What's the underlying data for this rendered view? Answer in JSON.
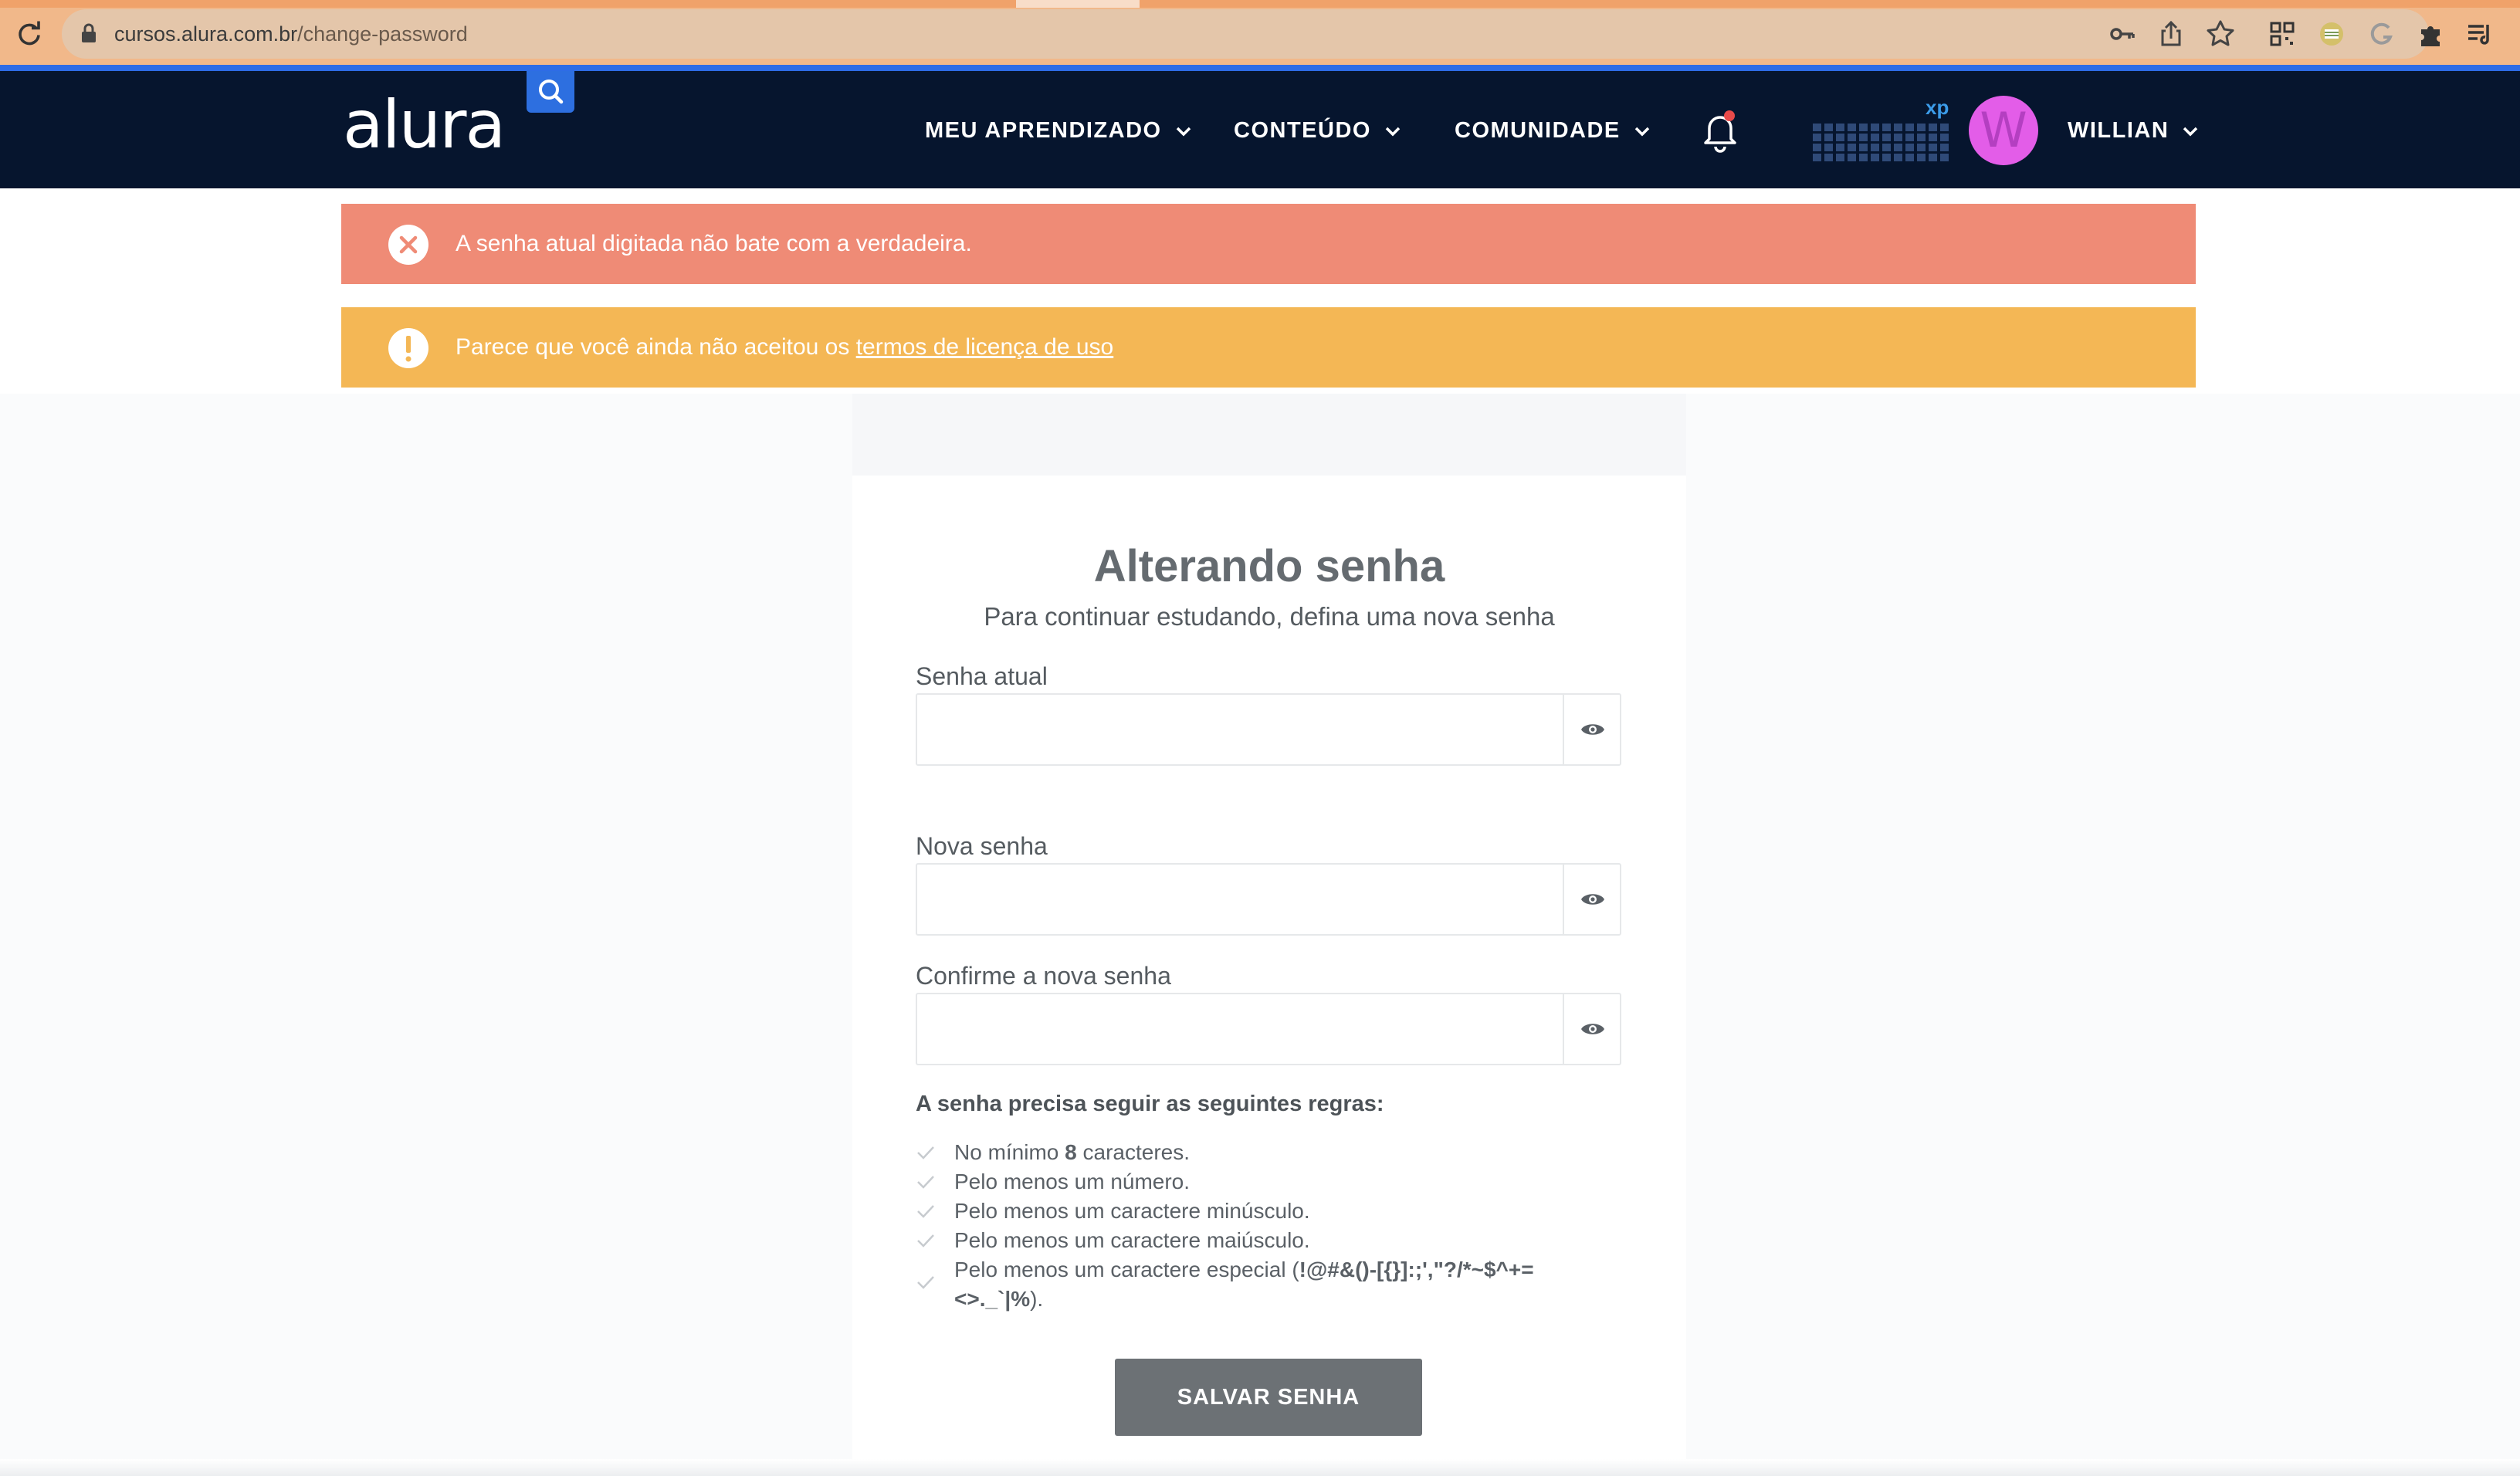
{
  "browser": {
    "url_domain": "cursos.alura.com.br",
    "url_path": "/change-password"
  },
  "header": {
    "logo": "alura",
    "nav": [
      {
        "label": "MEU APRENDIZADO"
      },
      {
        "label": "CONTEÚDO"
      },
      {
        "label": "COMUNIDADE"
      }
    ],
    "xp_label": "xp",
    "avatar_letter": "W",
    "user_name": "WILLIAN"
  },
  "alerts": {
    "error_text": "A senha atual digitada não bate com a verdadeira.",
    "warning_text": "Parece que você ainda não aceitou os ",
    "warning_link": "termos de licença de uso"
  },
  "form": {
    "title": "Alterando senha",
    "subtitle": "Para continuar estudando, defina uma nova senha",
    "current_label": "Senha atual",
    "new_label": "Nova senha",
    "confirm_label": "Confirme a nova senha",
    "current_value": "",
    "new_value": "",
    "confirm_value": "",
    "rules_title": "A senha precisa seguir as seguintes regras:",
    "rules": {
      "min_prefix": "No mínimo ",
      "min_count": "8",
      "min_suffix": " caracteres.",
      "number": "Pelo menos um número.",
      "lowercase": "Pelo menos um caractere minúsculo.",
      "uppercase": "Pelo menos um caractere maiúsculo.",
      "special_prefix": "Pelo menos um caractere especial (",
      "special_chars_1": "!@#&()-[{}]:;',\"?/*~$^+=",
      "special_chars_2": "<>._`|%",
      "special_suffix": ")."
    },
    "save_label": "SALVAR SENHA"
  },
  "colors": {
    "header_bg": "#06152e",
    "error": "#ef8b76",
    "warning": "#f4b755",
    "search_button": "#2d6fe0",
    "avatar": "#e35de8",
    "save_button": "#6c7175"
  },
  "icons": {
    "reload": "reload-icon",
    "lock": "lock-icon",
    "search": "search-icon",
    "bell": "bell-icon",
    "error": "close-circle-icon",
    "warning": "exclamation-circle-icon",
    "eye": "eye-icon",
    "check": "check-icon"
  }
}
